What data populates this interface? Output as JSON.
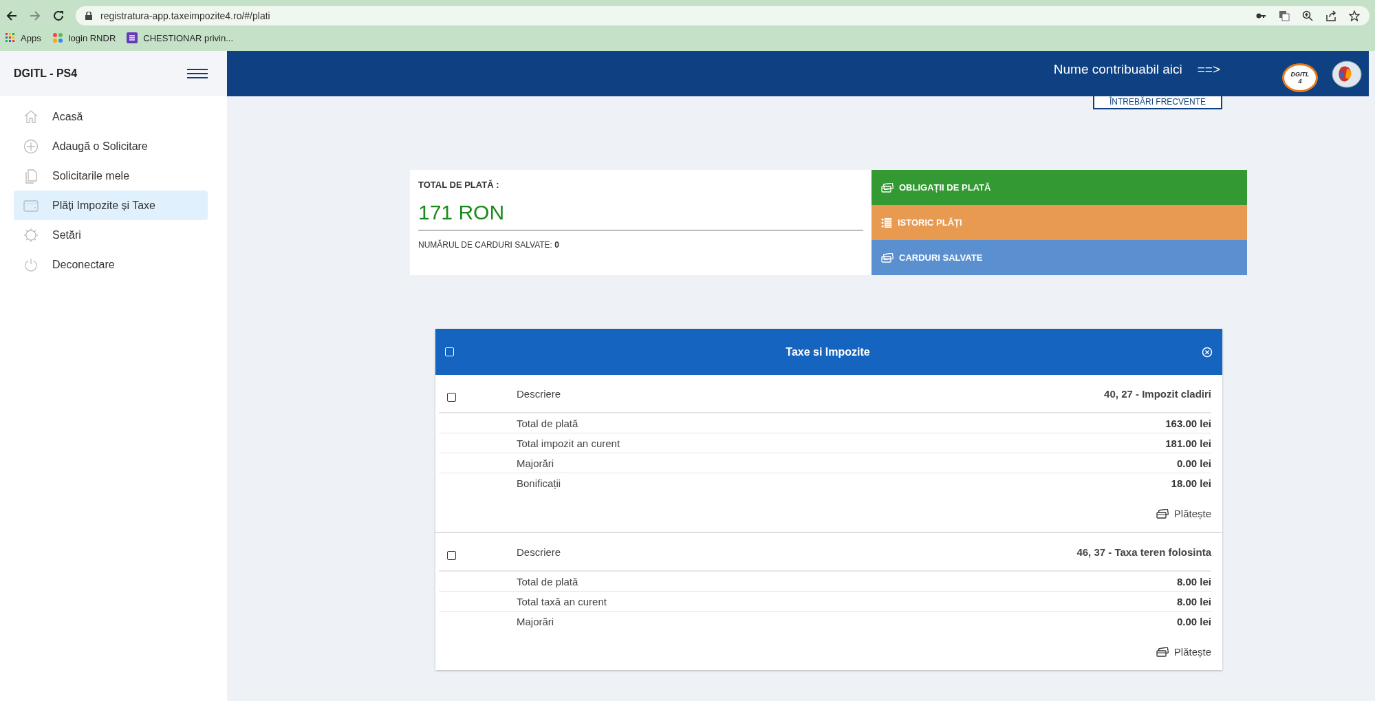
{
  "browser": {
    "url": "registratura-app.taxeimpozite4.ro/#/plati",
    "bookmarks": [
      {
        "label": "Apps",
        "kind": "apps"
      },
      {
        "label": "login RNDR",
        "kind": "star"
      },
      {
        "label": "CHESTIONAR privin...",
        "kind": "form"
      }
    ]
  },
  "sidebar": {
    "title": "DGITL - PS4",
    "items": [
      {
        "label": "Acasă",
        "kind": "home",
        "selected": false
      },
      {
        "label": "Adaugă o Solicitare",
        "kind": "plus",
        "selected": false
      },
      {
        "label": "Solicitarile mele",
        "kind": "docs",
        "selected": false
      },
      {
        "label": "Plăți Impozite și Taxe",
        "kind": "wallet",
        "selected": true
      },
      {
        "label": "Setări",
        "kind": "gear",
        "selected": false
      },
      {
        "label": "Deconectare",
        "kind": "power",
        "selected": false
      }
    ]
  },
  "header": {
    "user": "Nume contribuabil aici",
    "arrow": "==>",
    "logo_lines": [
      "DGITL",
      "4"
    ]
  },
  "faq_button": "ÎNTREBĂRI FRECVENTE",
  "summary": {
    "title": "TOTAL DE PLATĂ :",
    "amount": "171 RON",
    "cards_label": "NUMĂRUL DE CARDURI SALVATE:",
    "cards_count": "0",
    "actions": [
      {
        "label": "OBLIGAȚII DE PLATĂ",
        "kind": "cards",
        "color": "#339933"
      },
      {
        "label": "ISTORIC PLĂȚI",
        "kind": "list",
        "color": "#e89a50"
      },
      {
        "label": "CARDURI SALVATE",
        "kind": "cards",
        "color": "#5a8fd0"
      }
    ]
  },
  "panel": {
    "title": "Taxe si Impozite",
    "checked": false,
    "items": [
      {
        "checked": false,
        "desc_label": "Descriere",
        "description": "40, 27 - Impozit cladiri",
        "pay": "Plătește",
        "rows": [
          {
            "label": "Total de plată",
            "value": "163.00 lei"
          },
          {
            "label": "Total impozit an curent",
            "value": "181.00 lei"
          },
          {
            "label": "Majorări",
            "value": "0.00 lei"
          },
          {
            "label": "Bonificații",
            "value": "18.00 lei"
          }
        ]
      },
      {
        "checked": false,
        "desc_label": "Descriere",
        "description": "46, 37 - Taxa teren folosinta",
        "pay": "Plătește",
        "rows": [
          {
            "label": "Total de plată",
            "value": "8.00 lei"
          },
          {
            "label": "Total taxă an curent",
            "value": "8.00 lei"
          },
          {
            "label": "Majorări",
            "value": "0.00 lei"
          }
        ]
      }
    ]
  }
}
